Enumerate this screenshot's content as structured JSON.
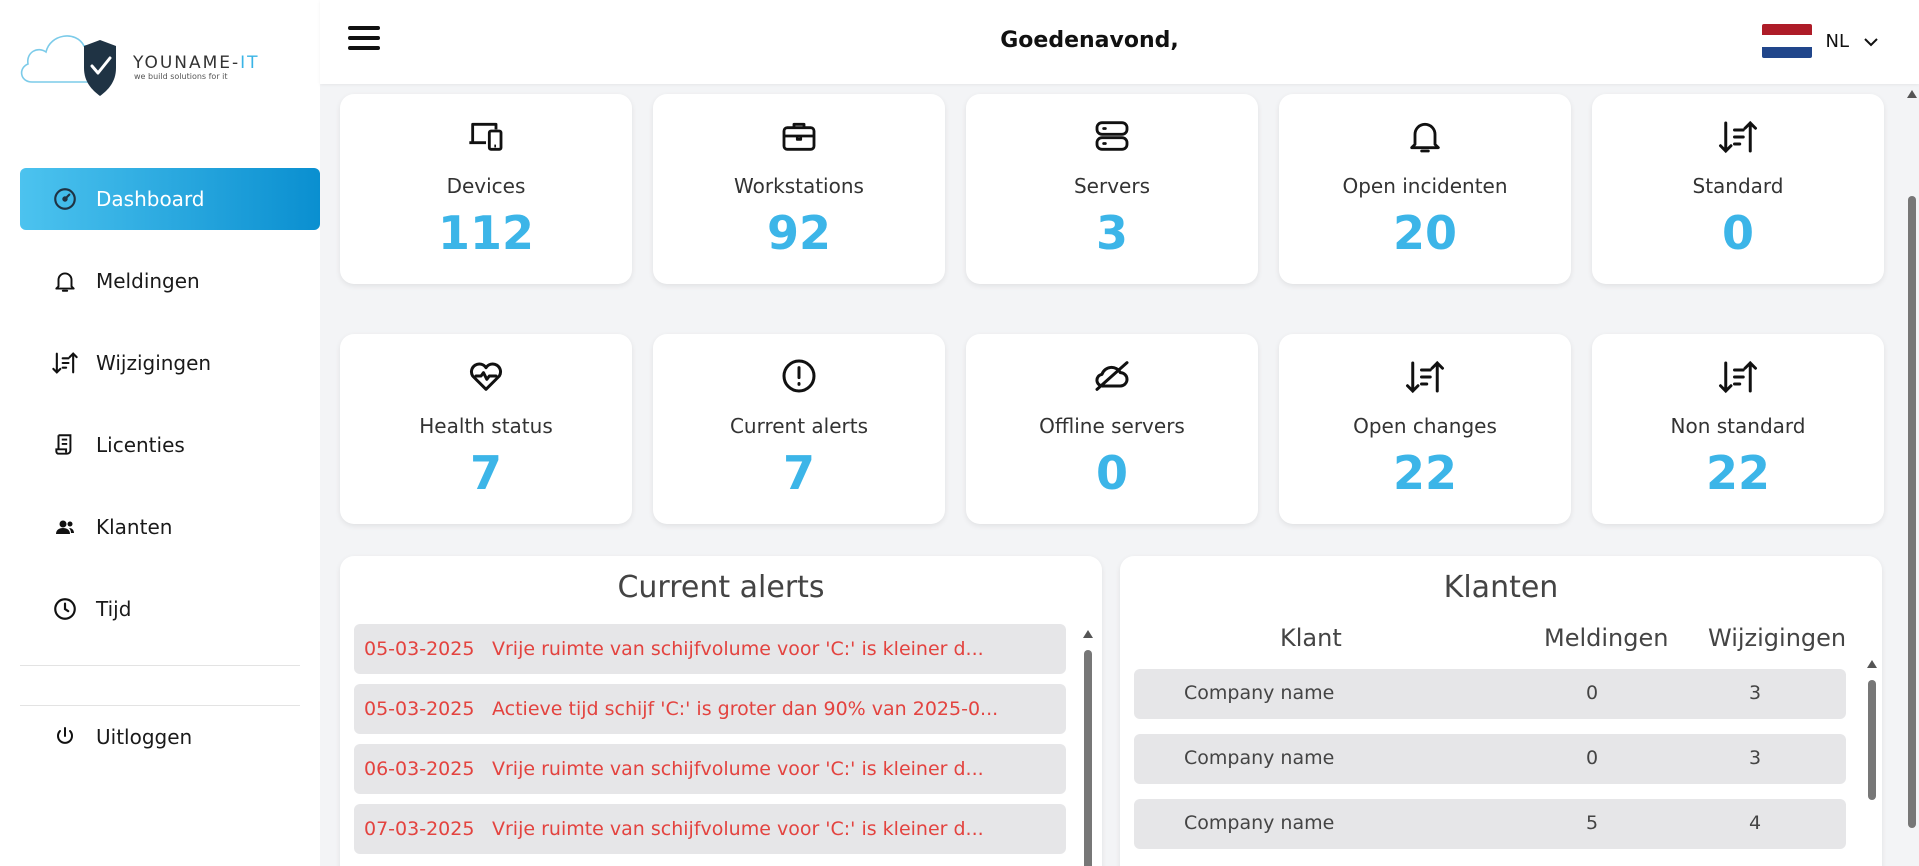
{
  "logo": {
    "title_main": "YOUNAME-",
    "title_accent": "IT",
    "tagline": "we build solutions for it"
  },
  "sidebar": {
    "items": [
      {
        "label": "Dashboard",
        "icon": "gauge-icon",
        "active": true
      },
      {
        "label": "Meldingen",
        "icon": "bell-icon"
      },
      {
        "label": "Wijzigingen",
        "icon": "sort-arrows-icon"
      },
      {
        "label": "Licenties",
        "icon": "document-icon"
      },
      {
        "label": "Klanten",
        "icon": "users-icon"
      },
      {
        "label": "Tijd",
        "icon": "clock-icon"
      }
    ],
    "logout_label": "Uitloggen"
  },
  "header": {
    "greeting": "Goedenavond,",
    "language": "NL"
  },
  "colors": {
    "accent": "#3cb5e8",
    "active_start": "#4cc3ef",
    "active_end": "#0a8fd0",
    "alert_text": "#e3433f"
  },
  "stats_row1": [
    {
      "label": "Devices",
      "value": "112",
      "icon": "devices-icon"
    },
    {
      "label": "Workstations",
      "value": "92",
      "icon": "briefcase-icon"
    },
    {
      "label": "Servers",
      "value": "3",
      "icon": "server-icon"
    },
    {
      "label": "Open incidenten",
      "value": "20",
      "icon": "bell-icon"
    },
    {
      "label": "Standard",
      "value": "0",
      "icon": "sort-arrows-icon"
    }
  ],
  "stats_row2": [
    {
      "label": "Health status",
      "value": "7",
      "icon": "heart-pulse-icon"
    },
    {
      "label": "Current alerts",
      "value": "7",
      "icon": "alert-circle-icon"
    },
    {
      "label": "Offline servers",
      "value": "0",
      "icon": "cloud-off-icon"
    },
    {
      "label": "Open changes",
      "value": "22",
      "icon": "sort-arrows-icon"
    },
    {
      "label": "Non standard",
      "value": "22",
      "icon": "sort-arrows-icon"
    }
  ],
  "alerts_panel": {
    "title": "Current alerts",
    "rows": [
      {
        "date": "05-03-2025",
        "message": "Vrije ruimte van schijfvolume voor 'C:' is kleiner d..."
      },
      {
        "date": "05-03-2025",
        "message": "Actieve tijd schijf 'C:' is groter dan 90% van 2025-0..."
      },
      {
        "date": "06-03-2025",
        "message": "Vrije ruimte van schijfvolume voor 'C:' is kleiner d..."
      },
      {
        "date": "07-03-2025",
        "message": "Vrije ruimte van schijfvolume voor 'C:' is kleiner d..."
      }
    ]
  },
  "klanten_panel": {
    "title": "Klanten",
    "columns": [
      "Klant",
      "Meldingen",
      "Wijzigingen"
    ],
    "rows": [
      {
        "klant": "Company name",
        "meldingen": "0",
        "wijzigingen": "3"
      },
      {
        "klant": "Company name",
        "meldingen": "0",
        "wijzigingen": "3"
      },
      {
        "klant": "Company name",
        "meldingen": "5",
        "wijzigingen": "4"
      }
    ]
  }
}
